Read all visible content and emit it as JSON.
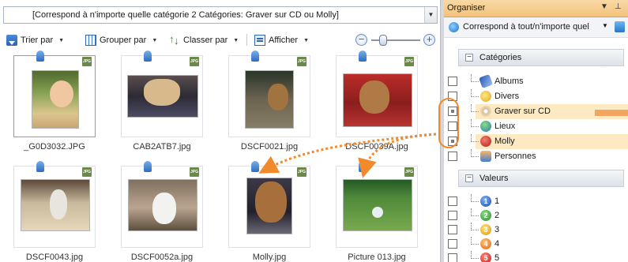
{
  "filter": {
    "text": "[Correspond à n'importe quelle catégorie 2 Catégories: Graver sur CD ou Molly]",
    "dropdown_glyph": "▼"
  },
  "toolbar": {
    "sort_label": "Trier par",
    "group_label": "Grouper par",
    "order_label": "Classer par",
    "view_label": "Afficher",
    "zoom_minus": "−",
    "zoom_plus": "+",
    "menu_arrow": "▼"
  },
  "thumbnails": [
    {
      "filename": "_G0D3032.JPG",
      "format": "JPG",
      "selected": true
    },
    {
      "filename": "CAB2ATB7.jpg",
      "format": "JPG"
    },
    {
      "filename": "DSCF0021.jpg",
      "format": "JPG"
    },
    {
      "filename": "DSCF0039A.jpg",
      "format": "JPG"
    },
    {
      "filename": "DSCF0043.jpg",
      "format": "JPG"
    },
    {
      "filename": "DSCF0052a.jpg",
      "format": "JPG"
    },
    {
      "filename": "Molly.jpg",
      "format": "JPG"
    },
    {
      "filename": "Picture 013.jpg",
      "format": "JPG"
    }
  ],
  "organizer": {
    "title": "Organiser",
    "header_controls": {
      "dropdown": "▼",
      "pin": "⊥"
    },
    "match_mode": "Correspond à tout/n'importe quel",
    "categories_header": "Catégories",
    "categories": [
      {
        "label": "Albums",
        "icon": "album-icon",
        "state": "unchecked"
      },
      {
        "label": "Divers",
        "icon": "lightbulb-icon",
        "state": "unchecked"
      },
      {
        "label": "Graver sur CD",
        "icon": "cd-icon",
        "state": "partial"
      },
      {
        "label": "Lieux",
        "icon": "globe-icon",
        "state": "unchecked"
      },
      {
        "label": "Molly",
        "icon": "molly-icon",
        "state": "partial"
      },
      {
        "label": "Personnes",
        "icon": "people-icon",
        "state": "unchecked"
      }
    ],
    "values_header": "Valeurs",
    "values": [
      {
        "label": "1"
      },
      {
        "label": "2"
      },
      {
        "label": "3"
      },
      {
        "label": "4"
      },
      {
        "label": "5"
      }
    ],
    "collapse_glyph": "−"
  },
  "colors": {
    "accent_orange": "#f08a2a",
    "header_orange": "#f3c27a",
    "highlight_row": "#fde9c2",
    "link_blue": "#1e6fc8"
  }
}
